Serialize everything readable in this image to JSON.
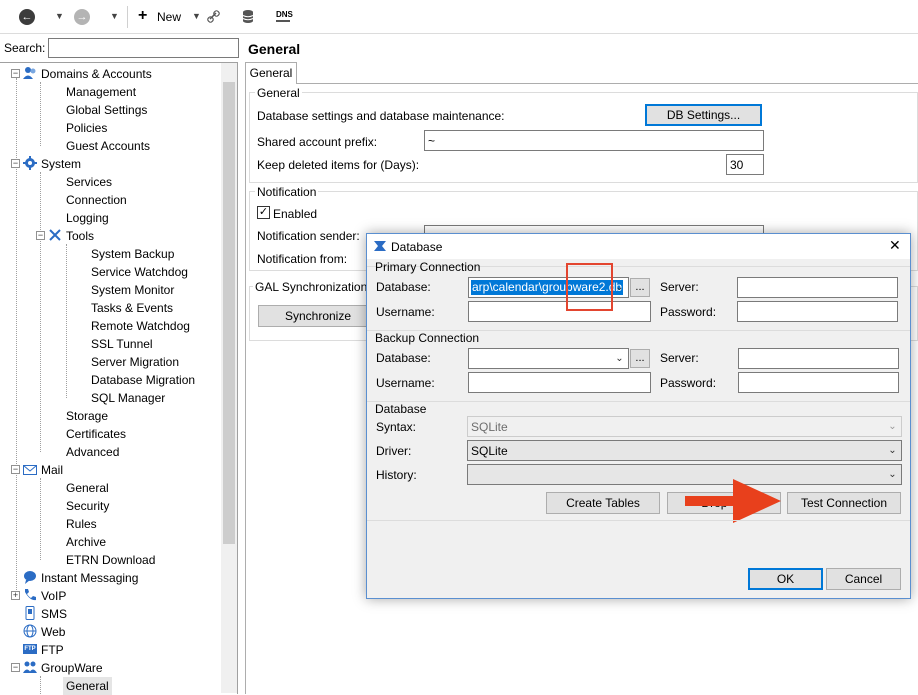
{
  "toolbar": {
    "new_label": "New",
    "dns_label": "DNS"
  },
  "search": {
    "label": "Search:",
    "value": ""
  },
  "tree": {
    "domains_accounts": "Domains & Accounts",
    "management": "Management",
    "global_settings": "Global Settings",
    "policies": "Policies",
    "guest_accounts": "Guest Accounts",
    "system": "System",
    "services": "Services",
    "connection": "Connection",
    "logging": "Logging",
    "tools": "Tools",
    "system_backup": "System Backup",
    "service_watchdog": "Service Watchdog",
    "system_monitor": "System Monitor",
    "tasks_events": "Tasks & Events",
    "remote_watchdog": "Remote Watchdog",
    "ssl_tunnel": "SSL Tunnel",
    "server_migration": "Server Migration",
    "database_migration": "Database Migration",
    "sql_manager": "SQL Manager",
    "storage": "Storage",
    "certificates": "Certificates",
    "advanced": "Advanced",
    "mail": "Mail",
    "mail_general": "General",
    "security": "Security",
    "rules": "Rules",
    "archive": "Archive",
    "etrn_download": "ETRN Download",
    "instant_messaging": "Instant Messaging",
    "voip": "VoIP",
    "sms": "SMS",
    "web": "Web",
    "ftp": "FTP",
    "groupware": "GroupWare",
    "groupware_general": "General"
  },
  "main": {
    "title": "General",
    "tab_general": "General",
    "general_group_title": "General",
    "db_settings_label": "Database settings and database maintenance:",
    "db_settings_button": "DB Settings...",
    "shared_prefix_label": "Shared account prefix:",
    "shared_prefix_value": "~",
    "keep_deleted_label": "Keep deleted items for (Days):",
    "keep_deleted_value": "30",
    "notification_group_title": "Notification",
    "enabled_label": "Enabled",
    "notification_sender_label": "Notification sender:",
    "notification_from_label": "Notification from:",
    "gal_group_title": "GAL Synchronization",
    "synchronize_button": "Synchronize"
  },
  "dialog": {
    "title": "Database",
    "close_glyph": "✕",
    "primary_title": "Primary Connection",
    "database_label": "Database:",
    "primary_database_value": "arp\\calendar\\groupware2.db",
    "browse_label": "...",
    "server_label": "Server:",
    "username_label": "Username:",
    "password_label": "Password:",
    "backup_title": "Backup Connection",
    "database_section_title": "Database",
    "syntax_label": "Syntax:",
    "syntax_value": "SQLite",
    "driver_label": "Driver:",
    "driver_value": "SQLite",
    "history_label": "History:",
    "create_tables_button": "Create Tables",
    "drop_tables_button": "Drop T...",
    "test_connection_button": "Test Connection",
    "ok_button": "OK",
    "cancel_button": "Cancel"
  },
  "colors": {
    "highlight_box": "#e3452f",
    "arrow": "#e8401c",
    "selection": "#0078d7"
  }
}
